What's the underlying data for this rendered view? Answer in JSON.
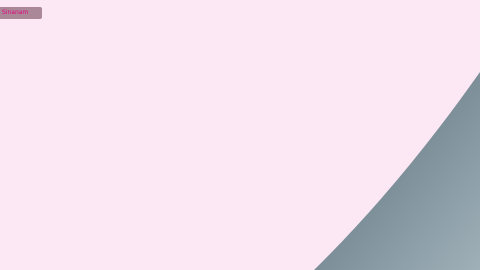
{
  "screen": {
    "background_color": "#fce8f4",
    "label_color": "#e6007e",
    "tab_color": "#aa8898",
    "shape_colors": [
      "#596e7a",
      "#9fb0b8"
    ]
  },
  "corner_tab": {
    "label": "Sinanam"
  }
}
